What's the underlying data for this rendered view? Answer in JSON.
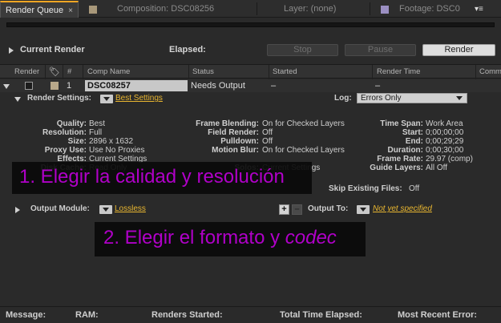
{
  "tabs": [
    {
      "label": "Render Queue",
      "close": "×",
      "active": true
    },
    {
      "label": "Composition: DSC08256",
      "swatch_color": "#a8987a"
    },
    {
      "label": "Layer: (none)"
    },
    {
      "label": "Footage: DSC0",
      "swatch_color": "#9b8fc2"
    }
  ],
  "panel_menu_icon": "▾≡",
  "current_render": {
    "label": "Current Render",
    "elapsed_label": "Elapsed:",
    "stop_label": "Stop",
    "pause_label": "Pause",
    "render_label": "Render"
  },
  "columns": {
    "render": "Render",
    "number": "#",
    "comp_name": "Comp Name",
    "status": "Status",
    "started": "Started",
    "render_time": "Render Time",
    "comment": "Comme"
  },
  "item": {
    "number": "1",
    "comp_name": "DSC08257",
    "status": "Needs Output",
    "started": "–",
    "render_time": "–"
  },
  "render_settings": {
    "label": "Render Settings:",
    "value": "Best Settings",
    "log_label": "Log:",
    "log_value": "Errors Only",
    "col1": [
      {
        "label": "Quality:",
        "value": "Best"
      },
      {
        "label": "Resolution:",
        "value": "Full"
      },
      {
        "label": "Size:",
        "value": "2896 x 1632"
      },
      {
        "label": "Proxy Use:",
        "value": "Use No Proxies"
      },
      {
        "label": "Effects:",
        "value": "Current Settings"
      },
      {
        "label": "Disk Cache:",
        "value": "Read Only"
      }
    ],
    "col2": [
      {
        "label": "Frame Blending:",
        "value": "On for Checked Layers"
      },
      {
        "label": "Field Render:",
        "value": "Off"
      },
      {
        "label": "Pulldown:",
        "value": "Off"
      },
      {
        "label": "Motion Blur:",
        "value": "On for Checked Layers"
      },
      {
        "label": "Solos:",
        "value": "Current Settings"
      }
    ],
    "col3": [
      {
        "label": "Time Span:",
        "value": "Work Area"
      },
      {
        "label": "Start:",
        "value": "0;00;00;00"
      },
      {
        "label": "End:",
        "value": "0;00;29;29"
      },
      {
        "label": "Duration:",
        "value": "0;00;30;00"
      },
      {
        "label": "Frame Rate:",
        "value": "29.97 (comp)"
      },
      {
        "label": "Guide Layers:",
        "value": "All Off"
      }
    ],
    "skip_label": "Skip Existing Files:",
    "skip_value": "Off"
  },
  "output_module": {
    "label": "Output Module:",
    "value": "Lossless",
    "plus": "+",
    "minus": "–",
    "output_to_label": "Output To:",
    "output_to_value": "Not yet specified"
  },
  "annotations": {
    "note1": "1. Elegir la calidad y resolución",
    "note2_prefix": "2. Elegir el formato y ",
    "note2_italic": "codec"
  },
  "status_bar": {
    "message": "Message:",
    "ram": "RAM:",
    "renders_started": "Renders Started:",
    "total_time_elapsed": "Total Time Elapsed:",
    "most_recent_error": "Most Recent Error:"
  },
  "colors": {
    "accent_tab": "#f5a623",
    "link": "#e9b630",
    "annotation_text": "#b000c8"
  }
}
